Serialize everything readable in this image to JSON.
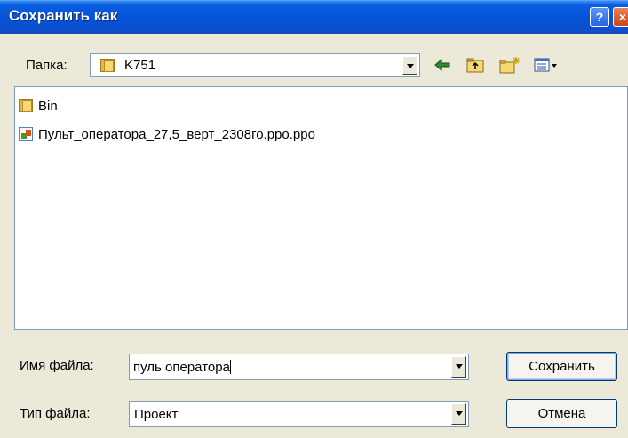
{
  "window": {
    "title": "Сохранить как",
    "help_label": "?",
    "close_label": "×"
  },
  "folder_bar": {
    "label": "Папка:",
    "current_folder": "K751",
    "icons": [
      "back-arrow-icon",
      "up-folder-icon",
      "new-folder-icon",
      "view-menu-icon"
    ]
  },
  "file_list": {
    "items": [
      {
        "name": "Bin",
        "icon": "folder-icon"
      },
      {
        "name": "Пульт_оператора_27,5_верт_2308го.ppo.ppo",
        "icon": "ppo-file-icon"
      }
    ]
  },
  "filename": {
    "label": "Имя файла:",
    "value": "пуль оператора"
  },
  "filetype": {
    "label": "Тип файла:",
    "value": "Проект"
  },
  "buttons": {
    "save": "Сохранить",
    "cancel": "Отмена"
  }
}
